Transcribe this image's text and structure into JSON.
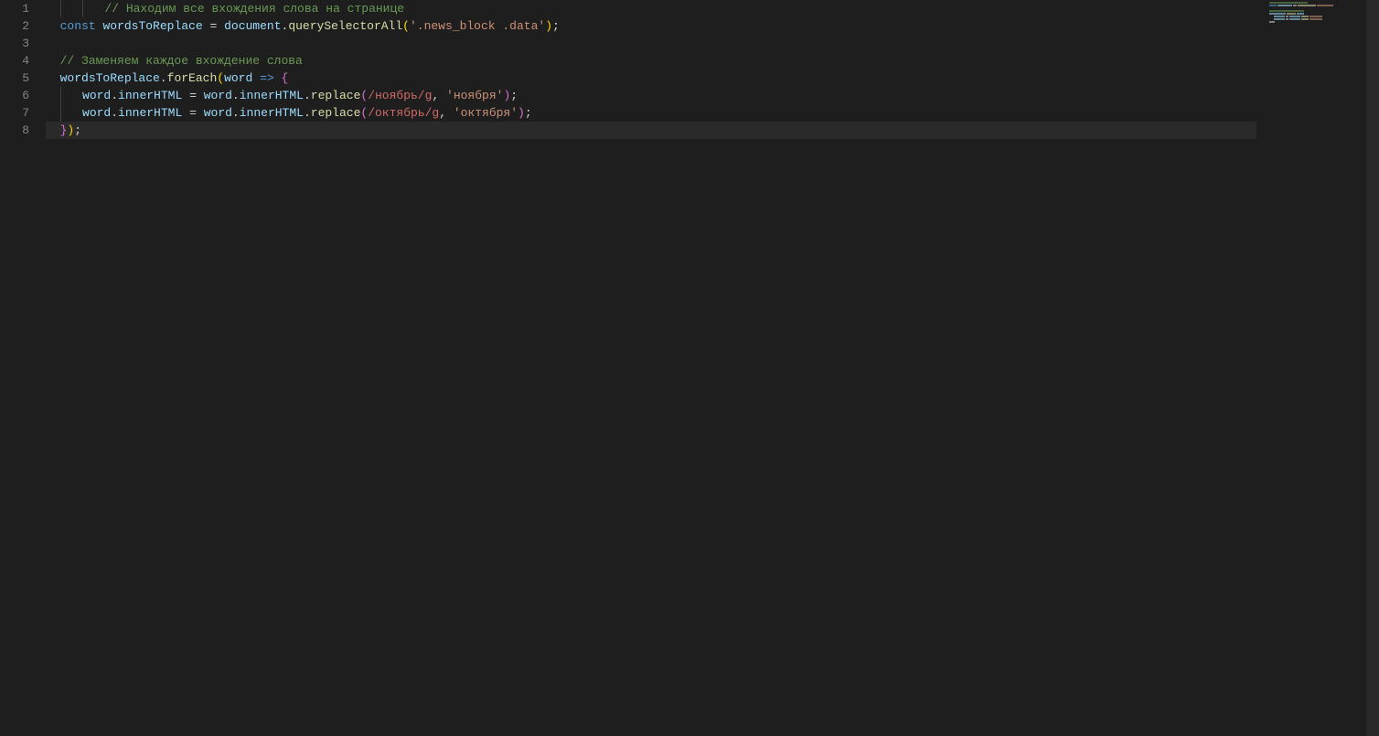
{
  "editor": {
    "currentLine": 8,
    "lines": [
      {
        "num": 1,
        "indent": 2,
        "tokens": [
          {
            "t": "comment",
            "v": "// Находим все вхождения слова на странице"
          }
        ]
      },
      {
        "num": 2,
        "indent": 0,
        "tokens": [
          {
            "t": "keyword",
            "v": "const"
          },
          {
            "t": "punc",
            "v": " "
          },
          {
            "t": "var",
            "v": "wordsToReplace"
          },
          {
            "t": "punc",
            "v": " "
          },
          {
            "t": "op",
            "v": "="
          },
          {
            "t": "punc",
            "v": " "
          },
          {
            "t": "obj",
            "v": "document"
          },
          {
            "t": "punc",
            "v": "."
          },
          {
            "t": "func",
            "v": "querySelectorAll"
          },
          {
            "t": "brace1",
            "v": "("
          },
          {
            "t": "string",
            "v": "'.news_block .data'"
          },
          {
            "t": "brace1",
            "v": ")"
          },
          {
            "t": "punc",
            "v": ";"
          }
        ]
      },
      {
        "num": 3,
        "indent": 0,
        "tokens": []
      },
      {
        "num": 4,
        "indent": 0,
        "tokens": [
          {
            "t": "comment",
            "v": "// Заменяем каждое вхождение слова"
          }
        ]
      },
      {
        "num": 5,
        "indent": 0,
        "tokens": [
          {
            "t": "obj",
            "v": "wordsToReplace"
          },
          {
            "t": "punc",
            "v": "."
          },
          {
            "t": "func",
            "v": "forEach"
          },
          {
            "t": "brace1",
            "v": "("
          },
          {
            "t": "var",
            "v": "word"
          },
          {
            "t": "punc",
            "v": " "
          },
          {
            "t": "keyword",
            "v": "=>"
          },
          {
            "t": "punc",
            "v": " "
          },
          {
            "t": "brace2",
            "v": "{"
          }
        ]
      },
      {
        "num": 6,
        "indent": 1,
        "tokens": [
          {
            "t": "obj",
            "v": "word"
          },
          {
            "t": "punc",
            "v": "."
          },
          {
            "t": "var",
            "v": "innerHTML"
          },
          {
            "t": "punc",
            "v": " "
          },
          {
            "t": "op",
            "v": "="
          },
          {
            "t": "punc",
            "v": " "
          },
          {
            "t": "obj",
            "v": "word"
          },
          {
            "t": "punc",
            "v": "."
          },
          {
            "t": "var",
            "v": "innerHTML"
          },
          {
            "t": "punc",
            "v": "."
          },
          {
            "t": "func",
            "v": "replace"
          },
          {
            "t": "brace2",
            "v": "("
          },
          {
            "t": "regex",
            "v": "/ноябрь/g"
          },
          {
            "t": "punc",
            "v": ", "
          },
          {
            "t": "string",
            "v": "'ноября'"
          },
          {
            "t": "brace2",
            "v": ")"
          },
          {
            "t": "punc",
            "v": ";"
          }
        ]
      },
      {
        "num": 7,
        "indent": 1,
        "tokens": [
          {
            "t": "obj",
            "v": "word"
          },
          {
            "t": "punc",
            "v": "."
          },
          {
            "t": "var",
            "v": "innerHTML"
          },
          {
            "t": "punc",
            "v": " "
          },
          {
            "t": "op",
            "v": "="
          },
          {
            "t": "punc",
            "v": " "
          },
          {
            "t": "obj",
            "v": "word"
          },
          {
            "t": "punc",
            "v": "."
          },
          {
            "t": "var",
            "v": "innerHTML"
          },
          {
            "t": "punc",
            "v": "."
          },
          {
            "t": "func",
            "v": "replace"
          },
          {
            "t": "brace2",
            "v": "("
          },
          {
            "t": "regex",
            "v": "/октябрь/g"
          },
          {
            "t": "punc",
            "v": ", "
          },
          {
            "t": "string",
            "v": "'октября'"
          },
          {
            "t": "brace2",
            "v": ")"
          },
          {
            "t": "punc",
            "v": ";"
          }
        ]
      },
      {
        "num": 8,
        "indent": 0,
        "tokens": [
          {
            "t": "brace2",
            "v": "}"
          },
          {
            "t": "brace1",
            "v": ")"
          },
          {
            "t": "punc",
            "v": ";"
          }
        ]
      }
    ]
  },
  "tokenClass": {
    "comment": "tok-comment",
    "keyword": "tok-keyword",
    "var": "tok-var",
    "obj": "tok-obj",
    "func": "tok-func",
    "string": "tok-string",
    "regex": "tok-regex",
    "punc": "tok-punc",
    "brace1": "tok-brace1",
    "brace2": "tok-brace2",
    "op": "tok-op"
  }
}
